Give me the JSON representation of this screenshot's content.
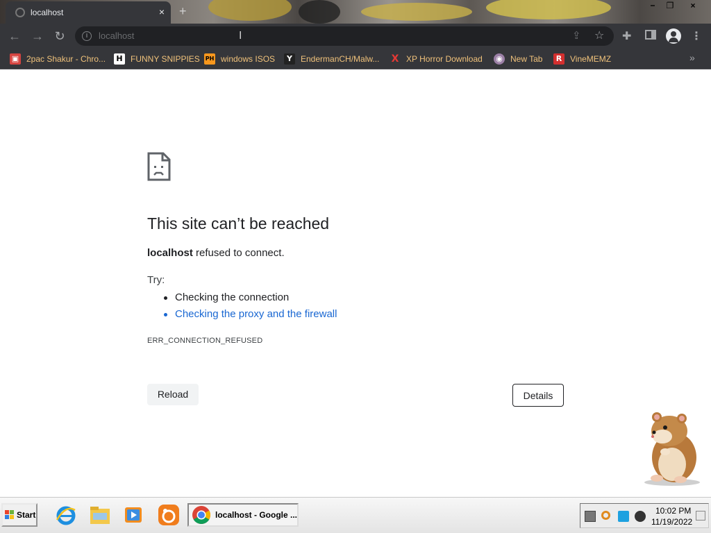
{
  "browser": {
    "tab": {
      "title": "localhost",
      "close_glyph": "×"
    },
    "new_tab_glyph": "+",
    "window_controls": {
      "minimize": "−",
      "maximize": "❐",
      "close": "×"
    },
    "toolbar": {
      "back_glyph": "←",
      "forward_glyph": "→",
      "reload_glyph": "↻",
      "url": "localhost",
      "info_glyph": "i",
      "star_glyph": "☆",
      "share_glyph": "⇪",
      "extensions_glyph": "✚",
      "menu_glyph": "⋮"
    },
    "bookmarks": [
      {
        "label": "2pac Shakur - Chro...",
        "icon": "gift-icon",
        "glyph": "🎁",
        "color": "#d64541"
      },
      {
        "label": "FUNNY SNIPPIES",
        "icon": "h-icon",
        "glyph": "H",
        "color": "#ffffff"
      },
      {
        "label": "windows ISOS",
        "icon": "ph-icon",
        "glyph": "PH",
        "color": "#f7971d"
      },
      {
        "label": "EndermanCH/Malw...",
        "icon": "yp-icon",
        "glyph": "Y",
        "color": "#444444"
      },
      {
        "label": "XP Horror Download",
        "icon": "x-icon",
        "glyph": "X",
        "color": "#e53935"
      },
      {
        "label": "New Tab",
        "icon": "globe-icon",
        "glyph": "◉",
        "color": "#9b7fa6"
      },
      {
        "label": "VineMEMZ",
        "icon": "r-icon",
        "glyph": "R",
        "color": "#d32f2f"
      }
    ],
    "bookmarks_overflow_glyph": "»"
  },
  "error_page": {
    "title": "This site can’t be reached",
    "host": "localhost",
    "message": " refused to connect.",
    "try_label": "Try:",
    "suggestions": [
      "Checking the connection",
      "Checking the proxy and the firewall"
    ],
    "error_code": "ERR_CONNECTION_REFUSED",
    "reload_label": "Reload",
    "details_label": "Details"
  },
  "taskbar": {
    "start_label": "Start",
    "apps": [
      "internet-explorer-icon",
      "file-explorer-icon",
      "media-player-icon",
      "uc-browser-icon"
    ],
    "active_task_label": "localhost - Google ...",
    "clock_time": "10:02 PM",
    "clock_date": "11/19/2022"
  },
  "colors": {
    "chrome_dark": "#35363a",
    "omnibox": "#202124",
    "bookmark_text": "#f0c27b",
    "link_blue": "#1967d2"
  }
}
